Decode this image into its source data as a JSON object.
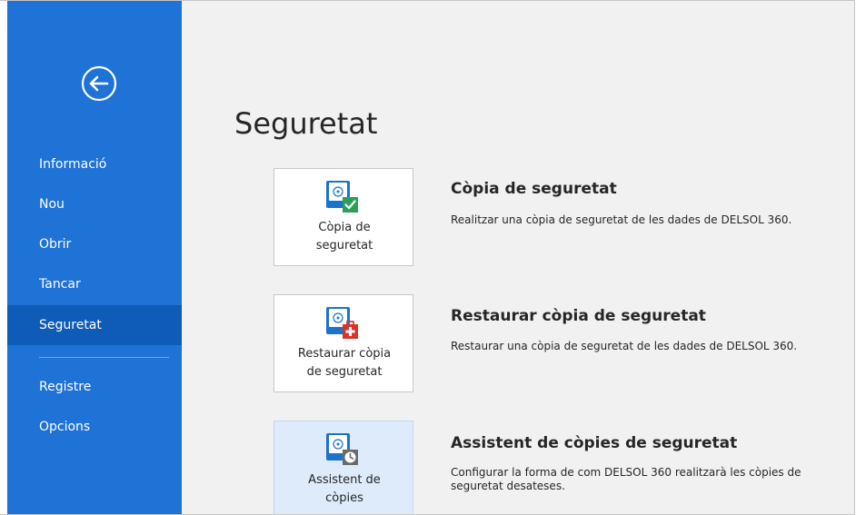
{
  "sidebar": {
    "items": [
      {
        "label": "Informació"
      },
      {
        "label": "Nou"
      },
      {
        "label": "Obrir"
      },
      {
        "label": "Tancar"
      },
      {
        "label": "Seguretat"
      },
      {
        "label": "Registre"
      },
      {
        "label": "Opcions"
      }
    ],
    "active_item": "Seguretat",
    "back_icon": "back-arrow-circle-icon"
  },
  "main": {
    "title": "Seguretat",
    "options": [
      {
        "tile_label": "Còpia de\nseguretat",
        "title": "Còpia de seguretat",
        "description": "Realitzar una còpia de seguretat de les dades de DELSOL 360.",
        "icon": "backup-disk-check-icon"
      },
      {
        "tile_label": "Restaurar còpia\nde seguretat",
        "title": "Restaurar còpia de seguretat",
        "description": "Restaurar una còpia de seguretat de les dades de DELSOL 360.",
        "icon": "restore-disk-medkit-icon"
      },
      {
        "tile_label": "Assistent de\ncòpies",
        "title": "Assistent de còpies de seguretat",
        "description": "Configurar la forma de com DELSOL 360 realitzarà les còpies de seguretat desateses.",
        "icon": "backup-wizard-clock-icon"
      }
    ]
  },
  "colors": {
    "sidebar": "#1f72d6",
    "sidebar_active": "#0f5bb8",
    "content_bg": "#f1f1f1",
    "tile_hover": "#deebfa",
    "disk_blue": "#1b74c9",
    "check_green": "#2e9e5a",
    "medkit_red": "#d9322b",
    "clock_gray": "#6b6b6b"
  }
}
